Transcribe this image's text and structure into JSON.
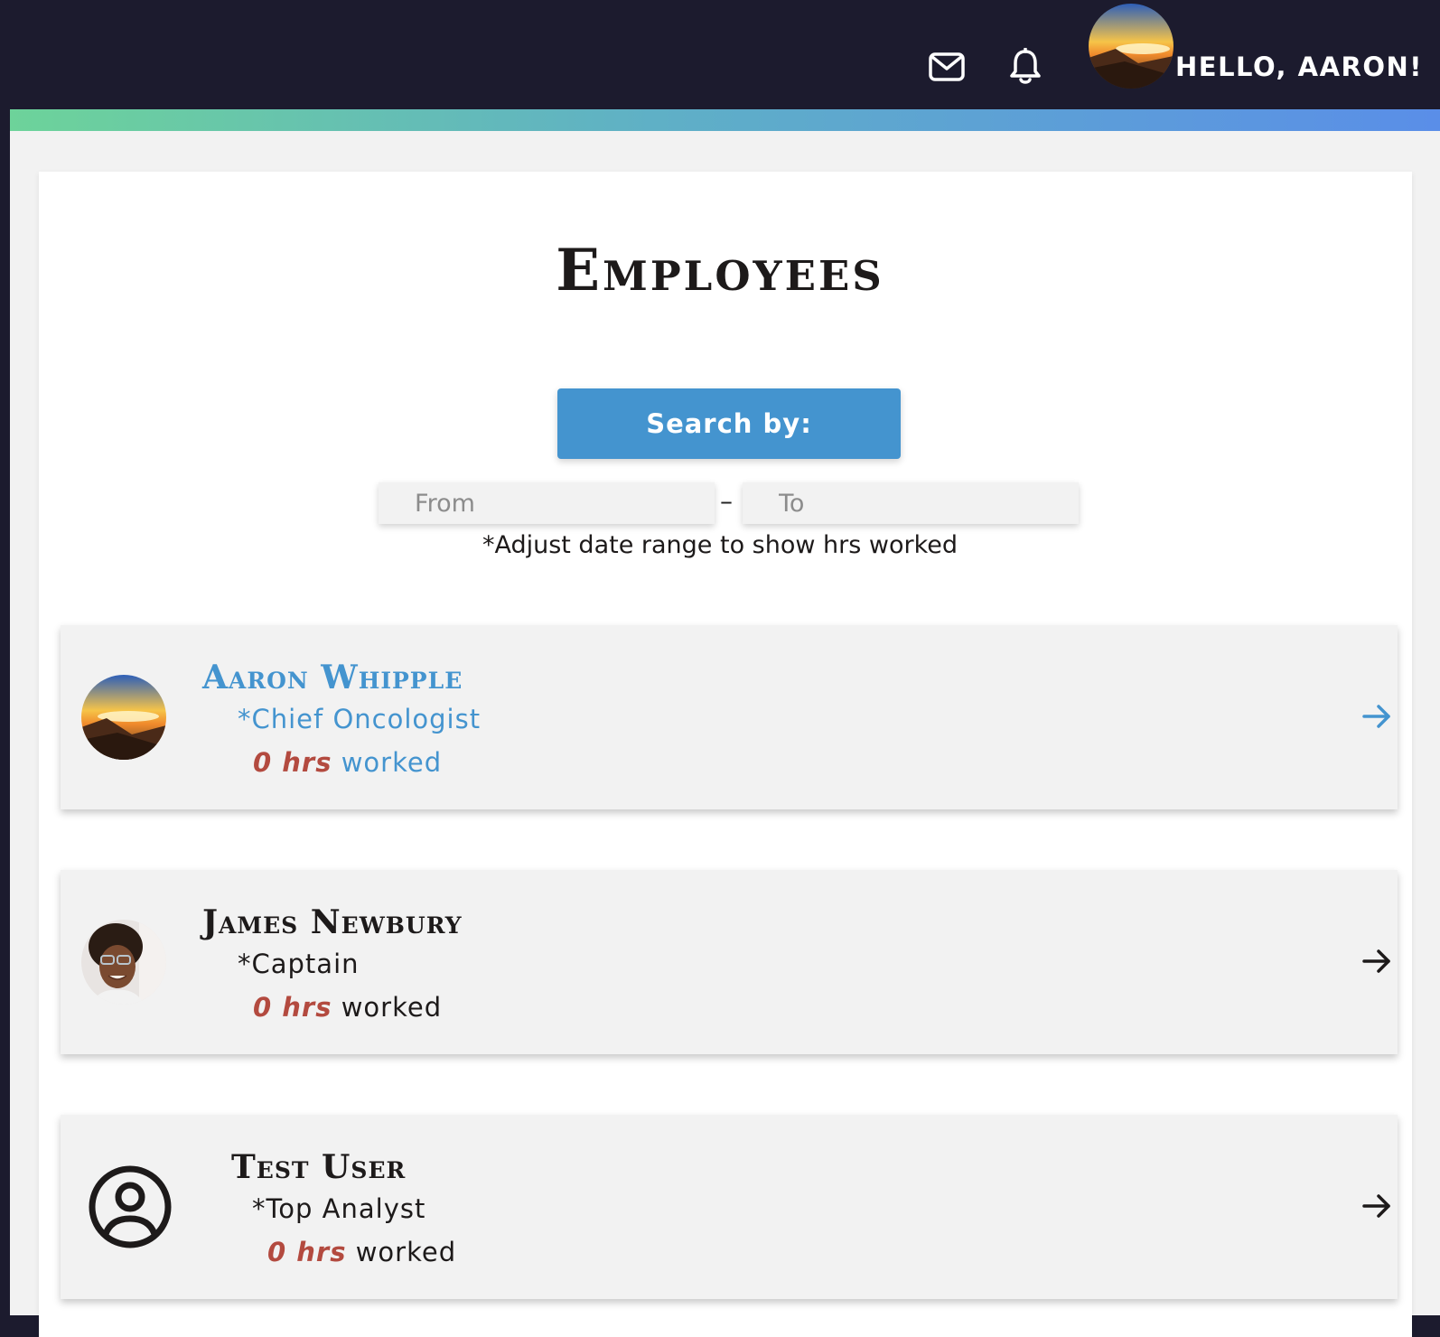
{
  "header": {
    "greeting": "HELLO, AARON!",
    "mail_icon": "mail-icon",
    "bell_icon": "bell-icon",
    "avatar": "user-avatar-sunset"
  },
  "main": {
    "title": "Employees",
    "search_button_label": "Search by:",
    "date_from_placeholder": "From",
    "date_to_placeholder": "To",
    "date_separator": "–",
    "date_hint": "*Adjust date range to show hrs worked"
  },
  "employees": [
    {
      "name": "Aaron Whipple",
      "role": "*Chief Oncologist",
      "hours": "0 hrs",
      "hours_suffix": "worked",
      "avatar": "sunset-photo",
      "accent": "#4494cf"
    },
    {
      "name": "James Newbury",
      "role": "*Captain",
      "hours": "0 hrs",
      "hours_suffix": "worked",
      "avatar": "person-photo",
      "accent": "#1d1a1a"
    },
    {
      "name": "Test User",
      "role": "*Top Analyst",
      "hours": "0 hrs",
      "hours_suffix": "worked",
      "avatar": "user-circle-icon",
      "accent": "#1d1a1a"
    }
  ],
  "colors": {
    "topbar": "#1c1b2e",
    "accent_blue": "#4494cf",
    "hours_red": "#b34a3f",
    "gradient_start": "#6dd39a",
    "gradient_end": "#5a8ee8"
  }
}
